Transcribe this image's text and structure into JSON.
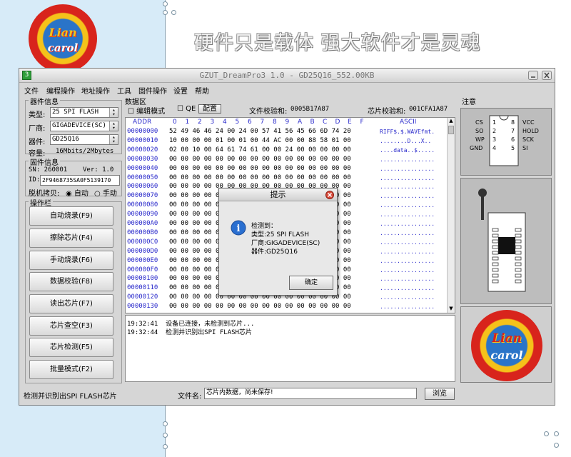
{
  "slogan": "硬件只是载体 强大软件才是灵魂",
  "logo": {
    "top_text": "Lian",
    "bottom_text": "carol"
  },
  "window": {
    "title": "GZUT_DreamPro3 1.0 - GD25Q16_552.00KB",
    "app_icon_text": "3"
  },
  "menu": [
    "文件",
    "编程操作",
    "地址操作",
    "工具",
    "固件操作",
    "设置",
    "帮助"
  ],
  "device_info": {
    "section_label": "器件信息",
    "type_label": "类型:",
    "type_value": "25 SPI FLASH",
    "vendor_label": "厂商:",
    "vendor_value": "GIGADEVICE(SC)",
    "device_label": "器件:",
    "device_value": "GD25Q16",
    "capacity_label": "容量:",
    "capacity_value": "16Mbits/2Mbytes"
  },
  "firmware_info": {
    "section_label": "固件信息",
    "sn": "SN: 260001",
    "ver": "Ver: 1.0",
    "id_label": "ID:",
    "id_value": "2F9468735SA0F5139170",
    "offline_label": "脱机拷贝:",
    "option_auto": "自动",
    "option_manual": "手动",
    "selected": "自动"
  },
  "operations": {
    "section_label": "操作栏",
    "buttons": [
      "自动烧录(F9)",
      "擦除芯片(F4)",
      "手动烧录(F6)",
      "数据校验(F8)",
      "读出芯片(F7)",
      "芯片查空(F3)",
      "芯片检测(F5)",
      "批量模式(F2)"
    ]
  },
  "data_area": {
    "section_label": "数据区",
    "edit_mode_label": "编辑模式",
    "qe_label": "QE",
    "config_button": "配置",
    "file_checksum_label": "文件校验和:",
    "file_checksum_value": "0005B17A87",
    "chip_checksum_label": "芯片校验和:",
    "chip_checksum_value": "001CFA1A87"
  },
  "hex": {
    "addr_header": "ADDR",
    "col_headers": [
      "0",
      "1",
      "2",
      "3",
      "4",
      "5",
      "6",
      "7",
      "8",
      "9",
      "A",
      "B",
      "C",
      "D",
      "E",
      "F"
    ],
    "ascii_header": "ASCII",
    "addresses": [
      "00000000",
      "00000010",
      "00000020",
      "00000030",
      "00000040",
      "00000050",
      "00000060",
      "00000070",
      "00000080",
      "00000090",
      "000000A0",
      "000000B0",
      "000000C0",
      "000000D0",
      "000000E0",
      "000000F0",
      "00000100",
      "00000110",
      "00000120",
      "00000130"
    ],
    "rows": [
      "52 49 46 46 24 00 24 00 57 41 56 45 66 6D 74 20",
      "10 00 00 00 01 00 01 00 44 AC 00 00 88 58 01 00",
      "02 00 10 00 64 61 74 61 00 00 24 00 00 00 00 00",
      "00 00 00 00 00 00 00 00 00 00 00 00 00 00 00 00",
      "00 00 00 00 00 00 00 00 00 00 00 00 00 00 00 00",
      "00 00 00 00 00 00 00 00 00 00 00 00 00 00 00 00",
      "00 00 00 00 00 00 00 00 00 00 00 00 00 00 00 00",
      "00 00 00 00 00 00 00 00 00 00 00 00 00 00 00 00",
      "00 00 00 00 00 00 00 00 00 00 00 00 00 00 00 00",
      "00 00 00 00 00 00 00 00 00 00 00 00 00 00 00 00",
      "00 00 00 00 00 00 00 00 00 00 00 00 00 00 00 00",
      "00 00 00 00 00 00 00 00 00 00 00 00 00 00 00 00",
      "00 00 00 00 00 00 00 00 00 00 00 00 00 00 00 00",
      "00 00 00 00 00 00 00 00 00 00 00 00 00 00 00 00",
      "00 00 00 00 00 00 00 00 00 00 00 00 00 00 00 00",
      "00 00 00 00 00 00 00 00 00 00 00 00 00 00 00 00",
      "00 00 00 00 00 00 00 00 00 00 00 00 00 00 00 00",
      "00 00 00 00 00 00 00 00 00 00 00 00 00 00 00 00",
      "00 00 00 00 00 00 00 00 00 00 00 00 00 00 00 00",
      "00 00 00 00 00 00 00 00 00 00 00 00 00 00 00 00"
    ],
    "ascii": [
      "RIFF$.$.WAVEfmt.",
      "........D...X..",
      "....data..$.....",
      "................",
      "................",
      "................",
      "................",
      "................",
      "................",
      "................",
      "................",
      "................",
      "................",
      "................",
      "................",
      "................",
      "................",
      "................",
      "................",
      "................"
    ]
  },
  "log": [
    "19:32:41  设备已连接，未检测到芯片...",
    "19:32:44  检测并识别出SPI FLASH芯片"
  ],
  "notice": {
    "section_label": "注意",
    "pins_left": [
      "CS",
      "SO",
      "WP",
      "GND"
    ],
    "pins_left_num": [
      "1",
      "2",
      "3",
      "4"
    ],
    "pins_right_num": [
      "8",
      "7",
      "6",
      "5"
    ],
    "pins_right": [
      "VCC",
      "HOLD",
      "SCK",
      "SI"
    ]
  },
  "dialog": {
    "title": "提示",
    "lines": [
      "检测到：",
      "类型:25 SPI FLASH",
      "厂商:GIGADEVICE(SC)",
      "器件:GD25Q16"
    ],
    "ok_button": "确定"
  },
  "statusbar": {
    "status_text": "检测并识别出SPI FLASH芯片",
    "file_name_label": "文件名:",
    "file_name_value": "芯片内数据，尚未保存!",
    "browse_button": "浏览"
  },
  "colors": {
    "accent_blue": "#2a2acb",
    "logo_red": "#d8241c",
    "logo_yellow": "#f5c21a",
    "logo_blue": "#2a74c8"
  }
}
